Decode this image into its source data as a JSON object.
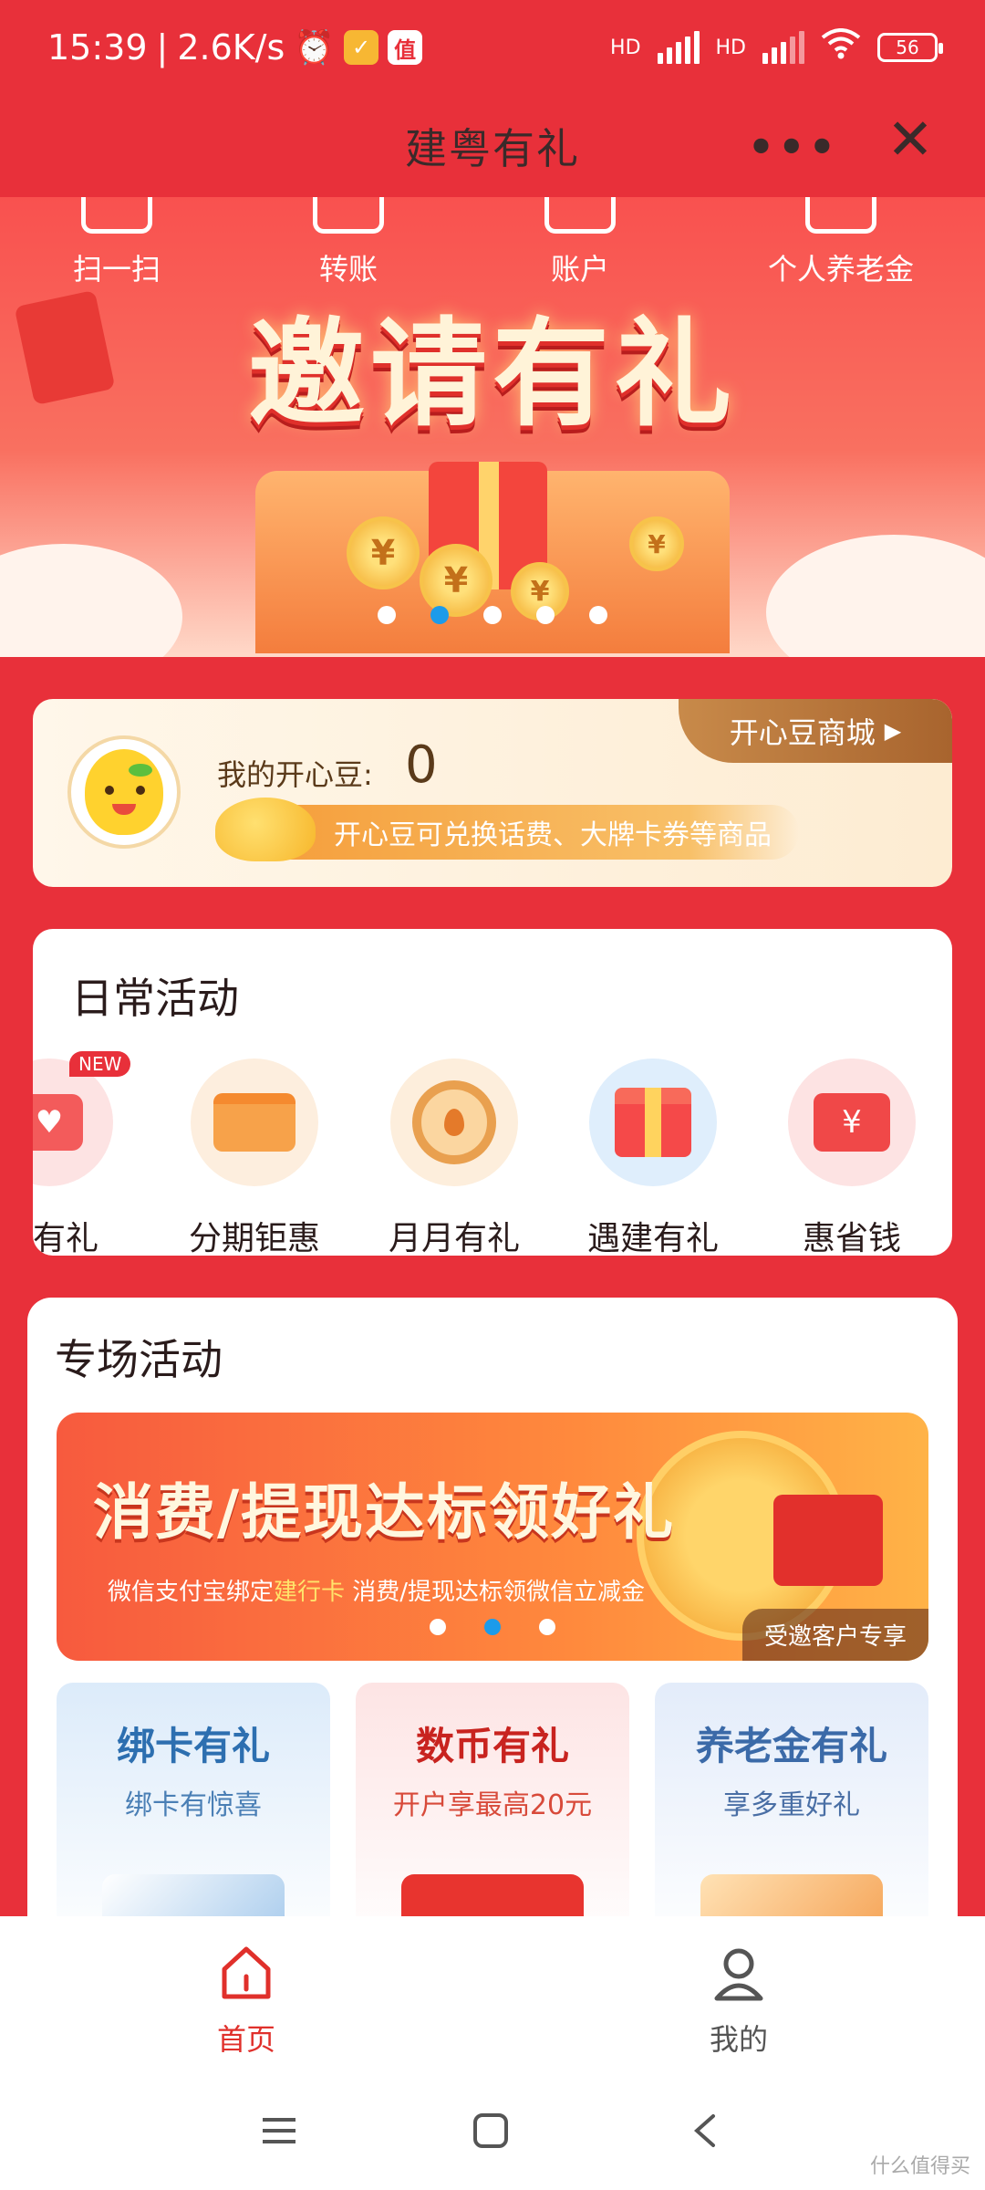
{
  "status_bar": {
    "time": "15:39",
    "speed": "2.6K/s",
    "battery": "56",
    "signal_1": "HD",
    "signal_2": "HD",
    "badge_value": "值"
  },
  "titlebar": {
    "title": "建粤有礼",
    "more": "•••",
    "close": "✕"
  },
  "banner": {
    "headline": "邀请有礼",
    "shortcuts": [
      "扫一扫",
      "转账",
      "账户",
      "个人养老金"
    ],
    "active_dot_index": 1,
    "dot_count": 5
  },
  "beans": {
    "label": "我的开心豆:",
    "value": "0",
    "mall_label": "开心豆商城",
    "tip": "开心豆可兑换话费、大牌卡券等商品"
  },
  "daily": {
    "title": "日常活动",
    "new_badge": "NEW",
    "items": [
      "请有礼",
      "分期钜惠",
      "月月有礼",
      "遇建有礼",
      "惠省钱"
    ]
  },
  "special": {
    "title": "专场活动",
    "promo": {
      "title": "消费/提现达标领好礼",
      "sub_before": "微信支付宝绑定",
      "sub_highlight": "建行卡",
      "sub_after": " 消费/提现达标领微信立减金",
      "tag": "受邀客户专享",
      "active_dot_index": 1,
      "dot_count": 3
    },
    "tiles": [
      {
        "title": "绑卡有礼",
        "subtitle": "绑卡有惊喜",
        "title_color": "#2d6fb0",
        "bg": "#dcebfa"
      },
      {
        "title": "数币有礼",
        "subtitle": "开户享最高20元",
        "title_color": "#c8231f",
        "bg": "#fde4e4"
      },
      {
        "title": "养老金有礼",
        "subtitle": "享多重好礼",
        "title_color": "#3b6aa8",
        "bg": "#e3ecfa"
      }
    ]
  },
  "bottom_nav": {
    "home": "首页",
    "mine": "我的",
    "active_color": "#e0302b"
  },
  "watermark": "什么值得买"
}
